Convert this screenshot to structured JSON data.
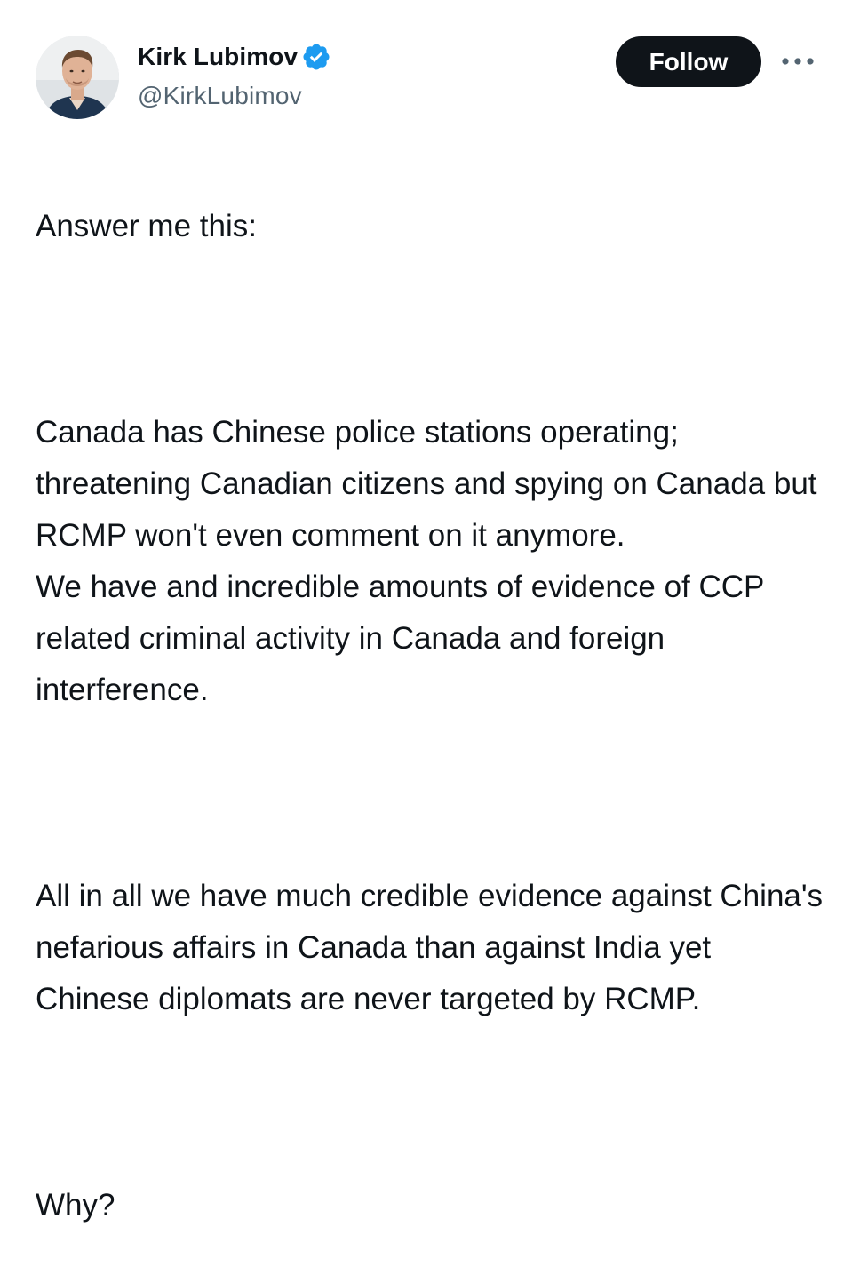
{
  "author": {
    "display_name": "Kirk Lubimov",
    "handle": "@KirkLubimov",
    "verified_icon": "verified-badge-icon",
    "avatar": "profile-photo"
  },
  "actions": {
    "follow_label": "Follow",
    "more_icon": "more-horizontal-icon"
  },
  "tweet": {
    "paragraphs": [
      "Answer me this:",
      "Canada has Chinese police stations operating; threatening Canadian citizens and spying on Canada but RCMP won't even comment on it anymore.\nWe have and incredible amounts of evidence of CCP related criminal activity in Canada and foreign interference.",
      "All in all we have much credible evidence against China's nefarious affairs in Canada than against India yet Chinese diplomats are never targeted by RCMP.",
      "Why?"
    ]
  },
  "colors": {
    "text": "#0f1419",
    "secondary_text": "#536471",
    "verified_blue": "#1d9bf0",
    "button_bg": "#0f1419",
    "button_text": "#ffffff"
  }
}
